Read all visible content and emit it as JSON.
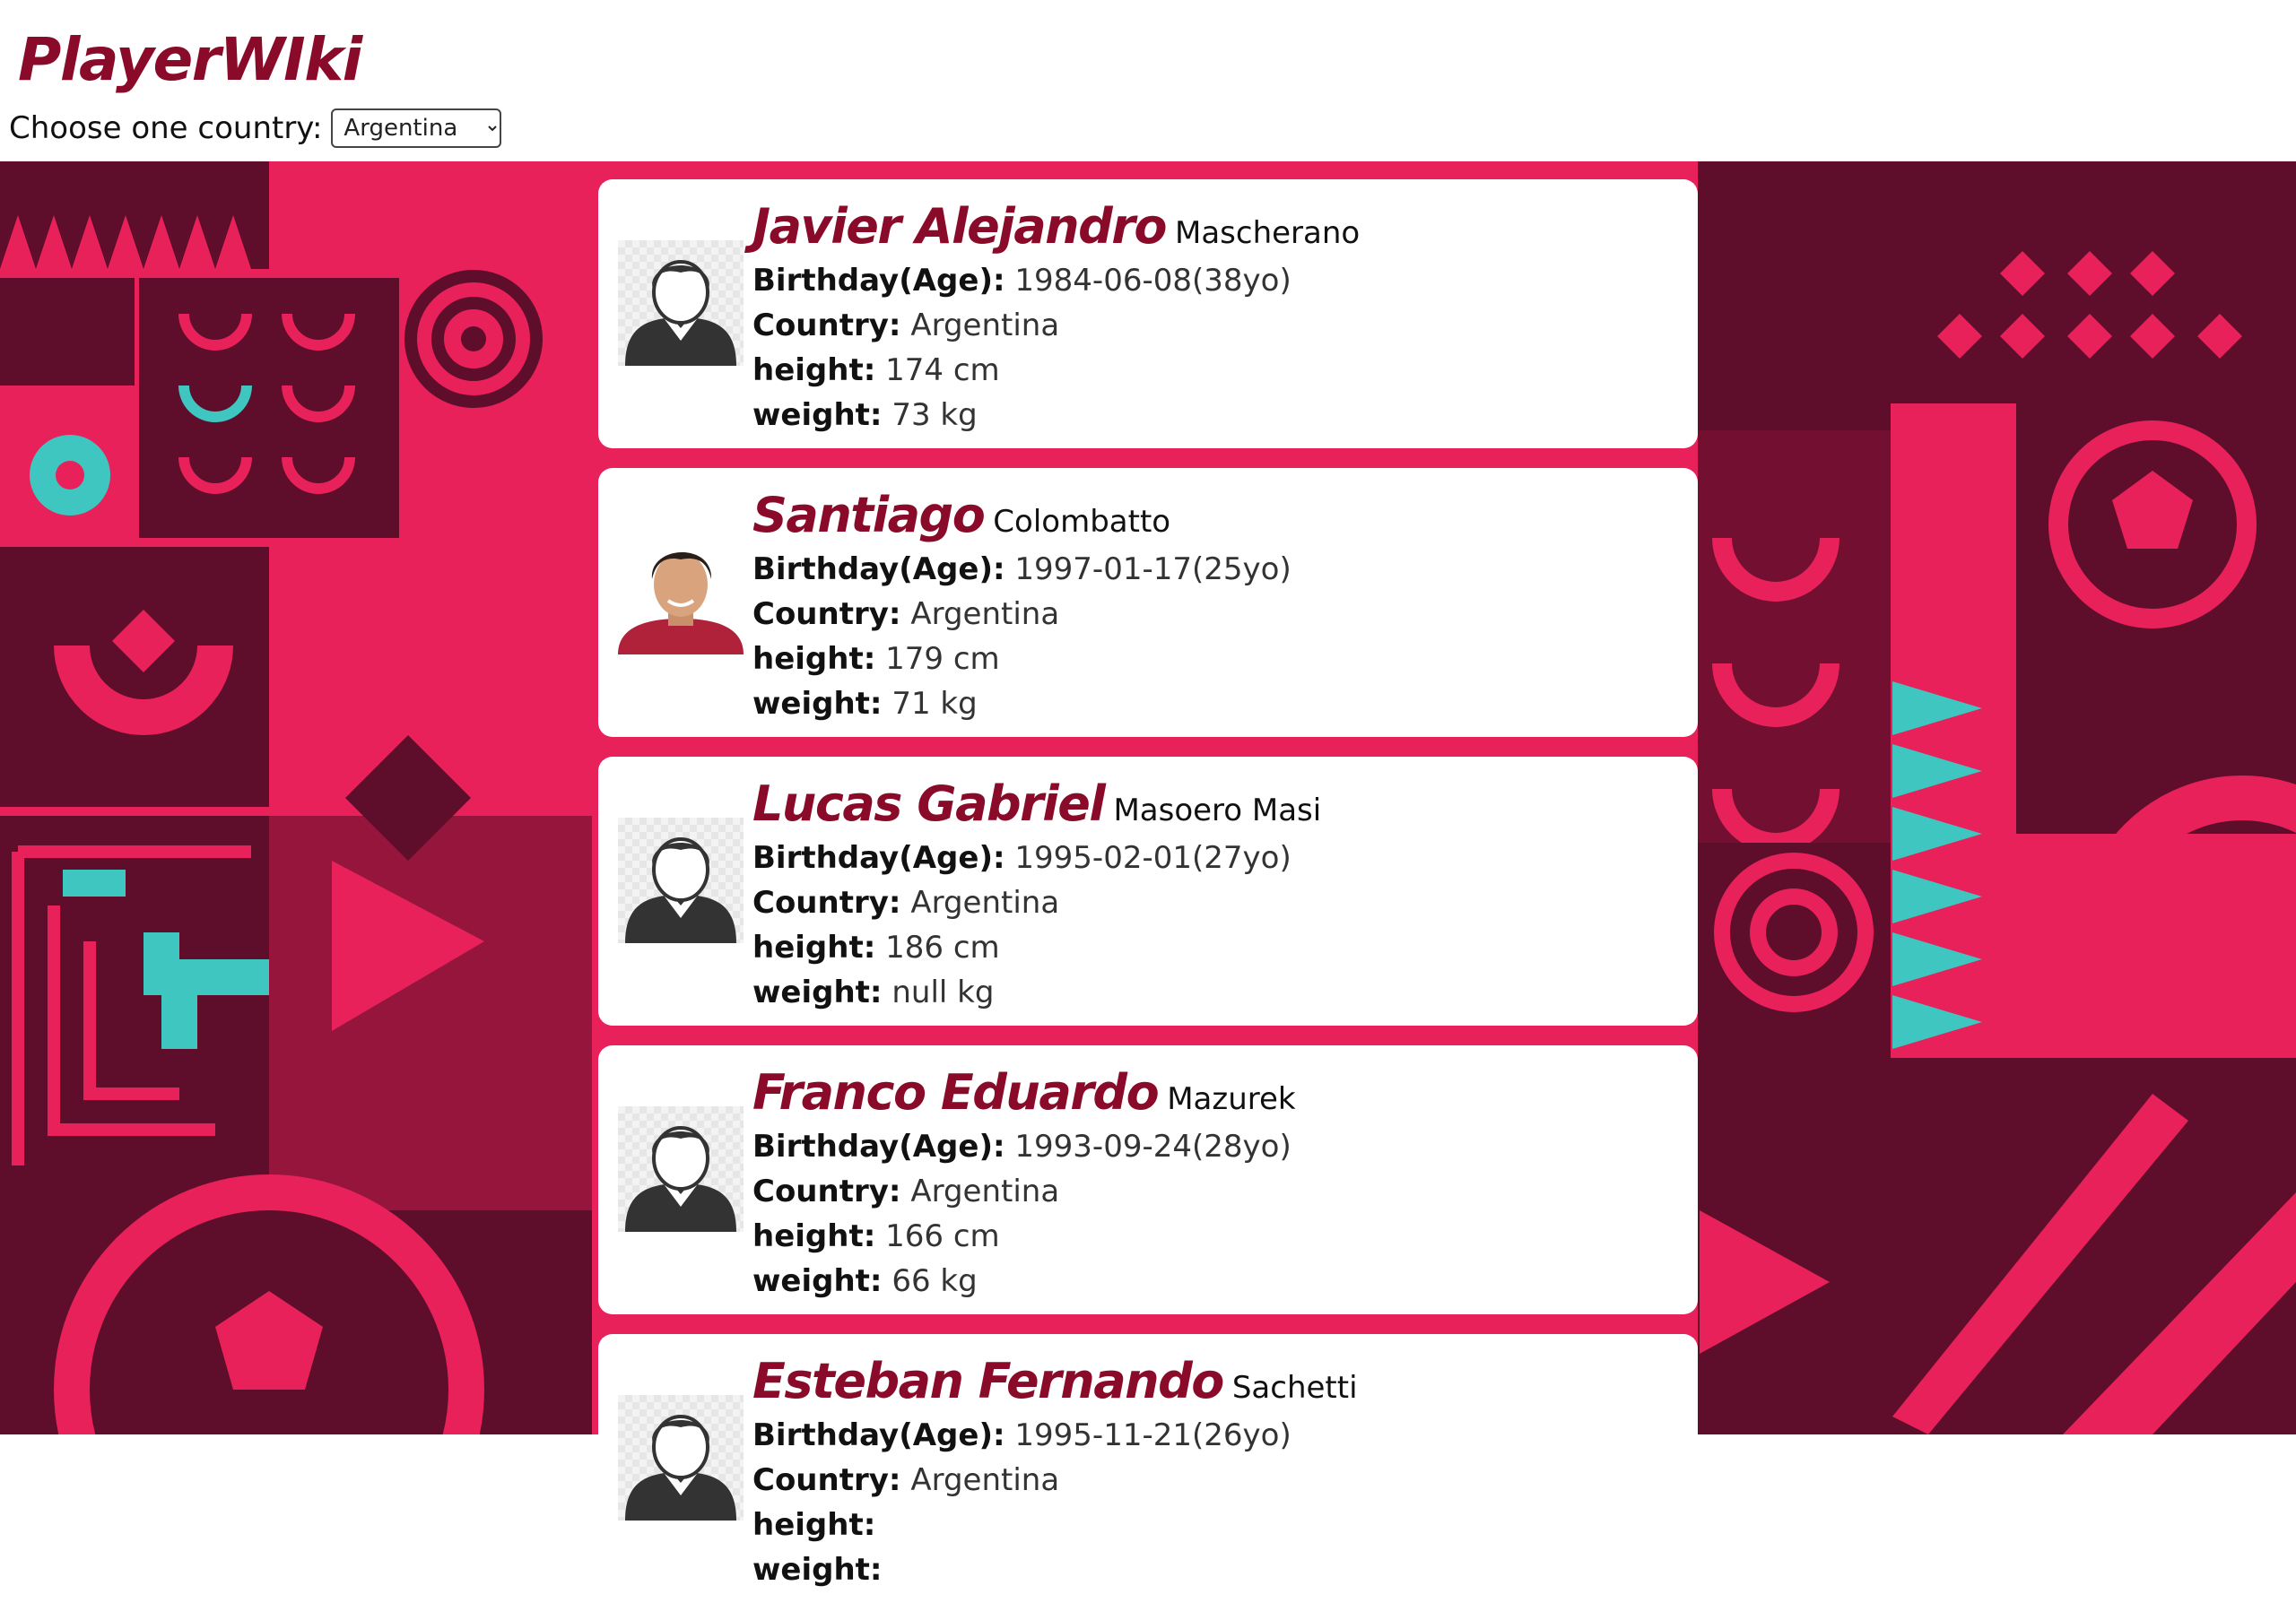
{
  "app": {
    "title": "PlayerWIki"
  },
  "filter": {
    "label": "Choose one country:",
    "selected": "Argentina"
  },
  "labels": {
    "birthday": "Birthday(Age):",
    "country": "Country:",
    "height": "height:",
    "weight": "weight:"
  },
  "players": [
    {
      "first_name": "Javier Alejandro",
      "last_name": "Mascherano",
      "birthday": "1984-06-08(38yo)",
      "country": "Argentina",
      "height": "174 cm",
      "weight": "73 kg",
      "photo": "default-avatar-icon"
    },
    {
      "first_name": "Santiago",
      "last_name": "Colombatto",
      "birthday": "1997-01-17(25yo)",
      "country": "Argentina",
      "height": "179 cm",
      "weight": "71 kg",
      "photo": "player-photo"
    },
    {
      "first_name": "Lucas Gabriel",
      "last_name": "Masoero Masi",
      "birthday": "1995-02-01(27yo)",
      "country": "Argentina",
      "height": "186 cm",
      "weight": "null kg",
      "photo": "default-avatar-icon"
    },
    {
      "first_name": "Franco Eduardo",
      "last_name": "Mazurek",
      "birthday": "1993-09-24(28yo)",
      "country": "Argentina",
      "height": "166 cm",
      "weight": "66 kg",
      "photo": "default-avatar-icon"
    },
    {
      "first_name": "Esteban Fernando",
      "last_name": "Sachetti",
      "birthday": "1995-11-21(26yo)",
      "country": "Argentina",
      "height": "",
      "weight": "",
      "photo": "default-avatar-icon"
    }
  ],
  "colors": {
    "brand": "#8a0a2a",
    "background_pink": "#e8215a",
    "background_maroon": "#5e0d2a",
    "accent_teal": "#3fc6c0"
  }
}
